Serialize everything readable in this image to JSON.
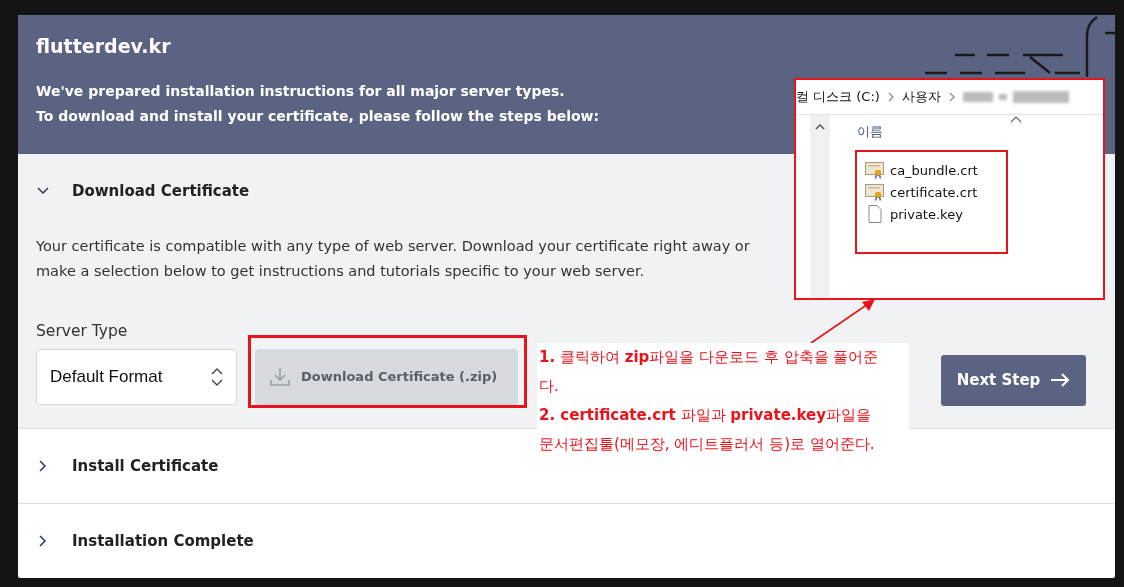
{
  "header": {
    "title": "flutterdev.kr",
    "intro": [
      "We've prepared installation instructions for all major server types.",
      "To download and install your certificate, please follow the steps below:"
    ]
  },
  "sections": [
    {
      "title": "Download Certificate",
      "expanded": true
    },
    {
      "title": "Install Certificate",
      "expanded": false
    },
    {
      "title": "Installation Complete",
      "expanded": false
    }
  ],
  "download_step": {
    "description": "Your certificate is compatible with any type of web server. Download your certificate right away or make a selection below to get instructions and tutorials specific to your web server.",
    "server_type_label": "Server Type",
    "server_type_value": "Default Format",
    "download_button": {
      "label": "Download Certificate (.zip)",
      "disabled": true
    },
    "next_button": "Next Step"
  },
  "explorer": {
    "breadcrumb": [
      "컬 디스크 (C:)",
      "사용자"
    ],
    "column_header": "이름",
    "files": [
      {
        "name": "ca_bundle.crt",
        "kind": "certificate"
      },
      {
        "name": "certificate.crt",
        "kind": "certificate"
      },
      {
        "name": "private.key",
        "kind": "file"
      }
    ]
  },
  "annotation": {
    "lines": [
      "**1.** 클릭하여 **zip**파일을 다운로드 후 압축을 풀어준다.",
      "**2. certificate.crt** 파일과 **private.key**파일을 문서편집툴(메모장, 에디트플러서 등)로 열어준다."
    ]
  }
}
